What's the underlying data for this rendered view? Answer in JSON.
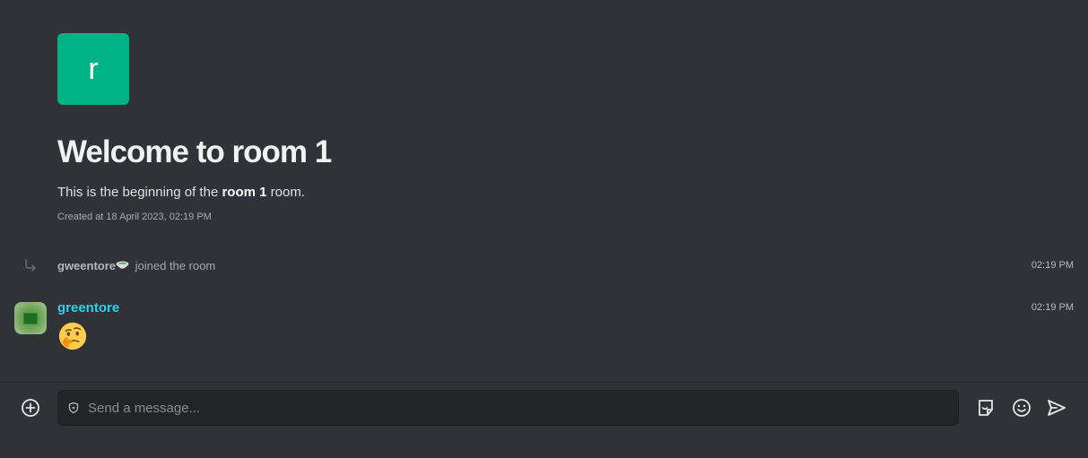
{
  "room": {
    "avatar_letter": "r",
    "avatar_color": "#00b386"
  },
  "welcome": {
    "title": "Welcome to room 1",
    "desc_prefix": "This is the beginning of the ",
    "room_name": "room 1",
    "desc_suffix": " room.",
    "created": "Created at 18 April 2023, 02:19 PM"
  },
  "timeline": {
    "join_event": {
      "user": "gweentore",
      "user_icon": "bowl-emoji-icon",
      "action": "joined the room",
      "time": "02:19 PM"
    },
    "message": {
      "username": "greentore",
      "username_color": "#27d3e8",
      "content_emoji": "thinking-face-emoji",
      "time": "02:19 PM"
    }
  },
  "composer": {
    "placeholder": "Send a message...",
    "buttons": [
      "add-icon",
      "sticker-icon",
      "emoji-icon",
      "send-icon"
    ]
  }
}
